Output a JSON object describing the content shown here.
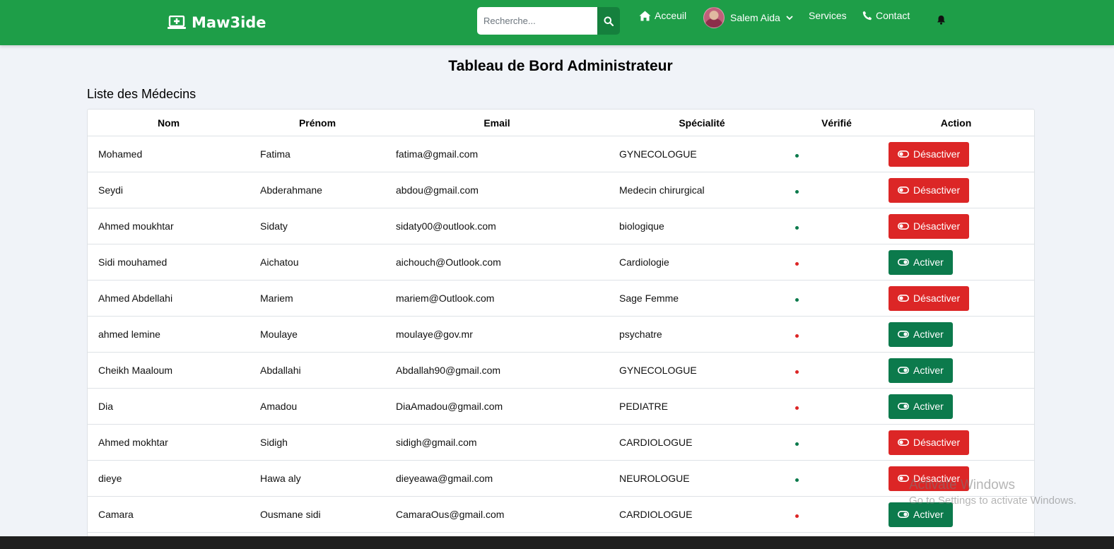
{
  "navbar": {
    "brand": "Maw3ide",
    "search_placeholder": "Recherche...",
    "home_label": "Acceuil",
    "user_name": "Salem Aida",
    "services_label": "Services",
    "contact_label": "Contact"
  },
  "main": {
    "title": "Tableau de Bord Administrateur",
    "section_title": "Liste des Médecins"
  },
  "table": {
    "headers": [
      "Nom",
      "Prénom",
      "Email",
      "Spécialité",
      "Vérifié",
      "Action"
    ],
    "rows": [
      {
        "nom": "Mohamed",
        "prenom": "Fatima",
        "email": "fatima@gmail.com",
        "specialite": "GYNECOLOGUE",
        "verified": true,
        "action": "Désactiver"
      },
      {
        "nom": "Seydi",
        "prenom": "Abderahmane",
        "email": "abdou@gmail.com",
        "specialite": "Medecin chirurgical",
        "verified": true,
        "action": "Désactiver"
      },
      {
        "nom": "Ahmed moukhtar",
        "prenom": "Sidaty",
        "email": "sidaty00@outlook.com",
        "specialite": "biologique",
        "verified": true,
        "action": "Désactiver"
      },
      {
        "nom": "Sidi mouhamed",
        "prenom": "Aichatou",
        "email": "aichouch@Outlook.com",
        "specialite": "Cardiologie",
        "verified": false,
        "action": "Activer"
      },
      {
        "nom": "Ahmed Abdellahi",
        "prenom": "Mariem",
        "email": "mariem@Outlook.com",
        "specialite": "Sage Femme",
        "verified": true,
        "action": "Désactiver"
      },
      {
        "nom": "ahmed lemine",
        "prenom": "Moulaye",
        "email": "moulaye@gov.mr",
        "specialite": "psychatre",
        "verified": false,
        "action": "Activer"
      },
      {
        "nom": "Cheikh Maaloum",
        "prenom": "Abdallahi",
        "email": "Abdallah90@gmail.com",
        "specialite": "GYNECOLOGUE",
        "verified": false,
        "action": "Activer"
      },
      {
        "nom": "Dia",
        "prenom": "Amadou",
        "email": "DiaAmadou@gmail.com",
        "specialite": "PEDIATRE",
        "verified": false,
        "action": "Activer"
      },
      {
        "nom": "Ahmed mokhtar",
        "prenom": "Sidigh",
        "email": "sidigh@gmail.com",
        "specialite": "CARDIOLOGUE",
        "verified": true,
        "action": "Désactiver"
      },
      {
        "nom": "dieye",
        "prenom": "Hawa aly",
        "email": "dieyeawa@gmail.com",
        "specialite": "NEUROLOGUE",
        "verified": true,
        "action": "Désactiver"
      },
      {
        "nom": "Camara",
        "prenom": "Ousmane sidi",
        "email": "CamaraOus@gmail.com",
        "specialite": "CARDIOLOGUE",
        "verified": false,
        "action": "Activer"
      }
    ]
  },
  "watermark": {
    "line1": "Activate Windows",
    "line2": "Go to Settings to activate Windows."
  },
  "colors": {
    "navbar": "#1e9e48",
    "verified_dot": "#0c7a4c",
    "unverified_dot": "#dc2626",
    "deactivate_button": "#dc2626",
    "activate_button": "#0c7a4c"
  },
  "icons": {
    "brand": "laptop-medical-icon",
    "search": "search-icon",
    "home": "home-icon",
    "chevron": "chevron-down-icon",
    "contact": "phone-icon",
    "notifications": "bell-icon",
    "toggle": "toggle-icon"
  }
}
